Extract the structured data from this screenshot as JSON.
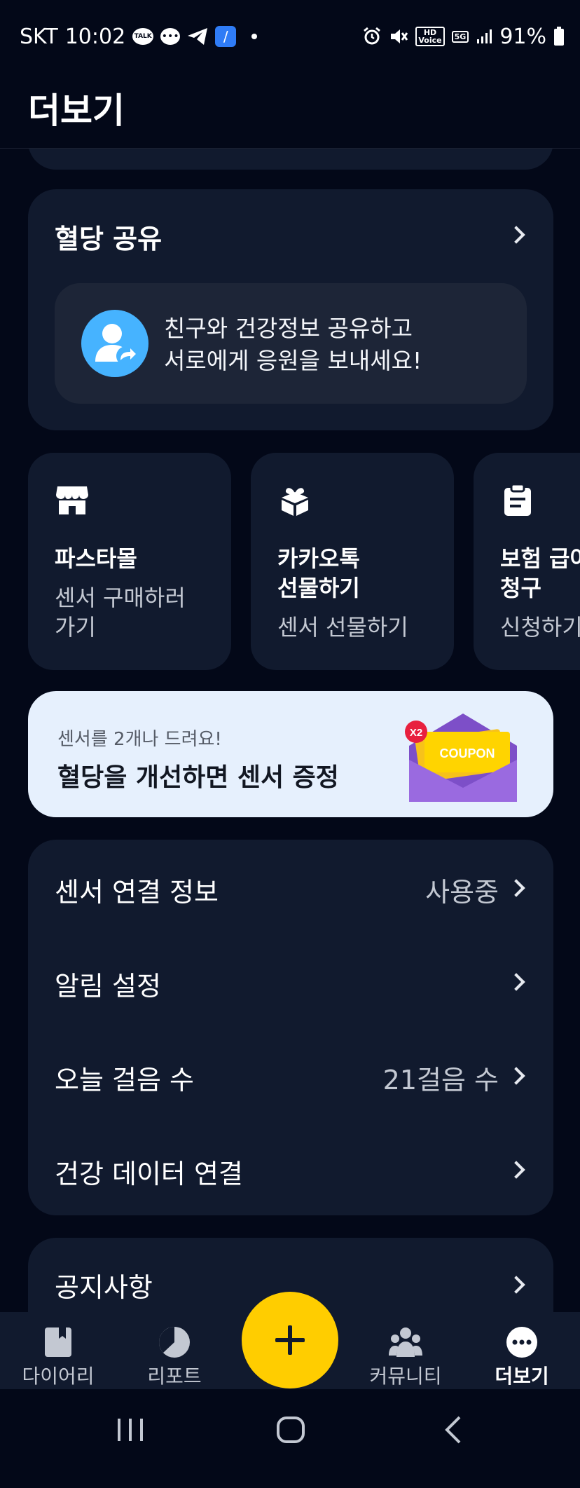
{
  "status_bar": {
    "carrier": "SKT",
    "time": "10:02",
    "talk_badge": "TALK",
    "hd_badge": "HD\nVoice",
    "network_badge": "5G",
    "battery": "91%"
  },
  "header": {
    "title": "더보기"
  },
  "share": {
    "title": "혈당 공유",
    "message_line1": "친구와 건강정보 공유하고",
    "message_line2": "서로에게 응원을 보내세요!"
  },
  "tiles": [
    {
      "title_line1": "파스타몰",
      "title_line2": "",
      "sub_line1": "센서 구매하러",
      "sub_line2": "가기",
      "icon": "store-icon"
    },
    {
      "title_line1": "카카오톡",
      "title_line2": "선물하기",
      "sub_line1": "센서 선물하기",
      "sub_line2": "",
      "icon": "gift-icon"
    },
    {
      "title_line1": "보험 급여",
      "title_line2": "청구",
      "sub_line1": "신청하기",
      "sub_line2": "",
      "icon": "clipboard-icon"
    }
  ],
  "banner": {
    "sub": "센서를 2개나 드려요!",
    "title": "혈당을 개선하면 센서 증정",
    "badge": "X2",
    "coupon_text": "COUPON"
  },
  "settings": [
    {
      "label": "센서 연결 정보",
      "value": "사용중"
    },
    {
      "label": "알림 설정",
      "value": ""
    },
    {
      "label": "오늘 걸음 수",
      "value": "21걸음 수"
    },
    {
      "label": "건강 데이터 연결",
      "value": ""
    }
  ],
  "notice": {
    "label": "공지사항"
  },
  "bottom_nav": [
    {
      "label": "다이어리",
      "icon": "diary-icon",
      "active": false
    },
    {
      "label": "리포트",
      "icon": "report-icon",
      "active": false
    },
    {
      "label": "커뮤니티",
      "icon": "community-icon",
      "active": false
    },
    {
      "label": "더보기",
      "icon": "more-icon",
      "active": true
    }
  ],
  "colors": {
    "background": "#030818",
    "card": "#111a2e",
    "accent_yellow": "#ffcd00",
    "avatar_blue": "#46b3ff",
    "banner_bg": "#e6f0fd",
    "coupon_purple": "#8f5fd6"
  }
}
